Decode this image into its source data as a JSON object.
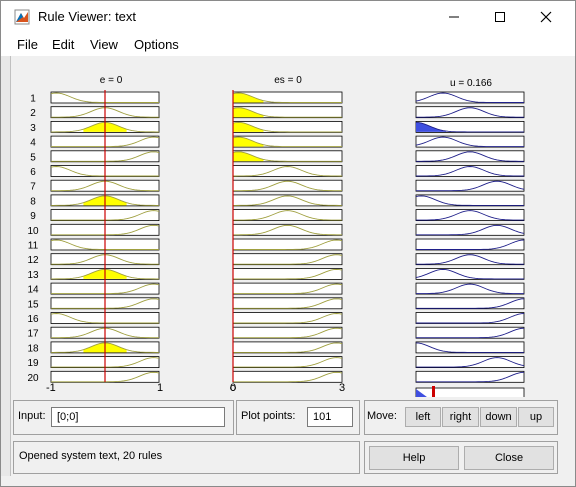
{
  "window": {
    "title": "Rule Viewer: text"
  },
  "menu": [
    "File",
    "Edit",
    "View",
    "Options"
  ],
  "headers": {
    "e": "e = 0",
    "es": "es = 0",
    "u": "u = 0.166"
  },
  "rule_numbers": [
    "1",
    "2",
    "3",
    "4",
    "5",
    "6",
    "7",
    "8",
    "9",
    "10",
    "11",
    "12",
    "13",
    "14",
    "15",
    "16",
    "17",
    "18",
    "19",
    "20"
  ],
  "axes": {
    "e": {
      "min": "-1",
      "max": "1"
    },
    "es": {
      "min": "0",
      "max": "3"
    }
  },
  "input": {
    "label": "Input:",
    "value": "[0;0]"
  },
  "plot_points": {
    "label": "Plot points:",
    "value": "101"
  },
  "move": {
    "label": "Move:",
    "buttons": [
      "left",
      "right",
      "down",
      "up"
    ]
  },
  "status": "Opened system text, 20 rules",
  "buttons": {
    "help": "Help",
    "close": "Close"
  },
  "colors": {
    "fill_input": "#ffff00",
    "fill_output": "#3f4fe0",
    "cursor": "#cc0000",
    "curve_input": "#a0a040",
    "curve_output": "#20208a"
  }
}
